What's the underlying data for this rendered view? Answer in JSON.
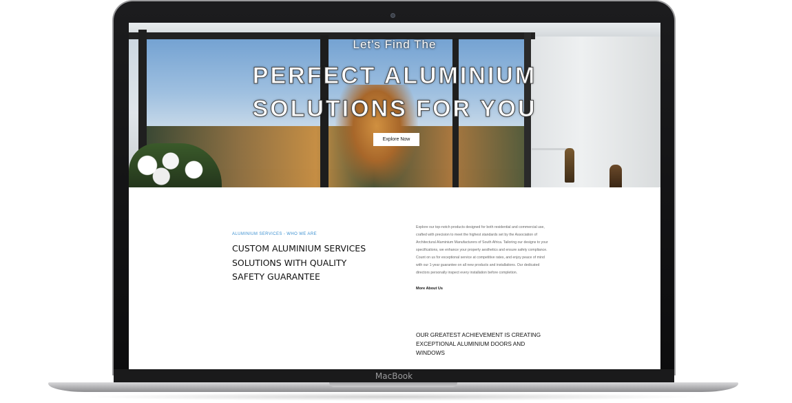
{
  "device": {
    "brand_label": "MacBook"
  },
  "hero": {
    "kicker": "Let's Find The",
    "title_line1": "PERFECT ALUMINIUM",
    "title_line2": "SOLUTIONS FOR YOU",
    "cta_label": "Explore Now"
  },
  "about": {
    "kicker": "ALUMINIUM SERVICES - WHO WE ARE",
    "headline_lines": [
      "CUSTOM ALUMINIUM SERVICES",
      "SOLUTIONS WITH QUALITY",
      "SAFETY GUARANTEE"
    ],
    "body_lines": [
      "Explore our top-notch products designed for both residential and commercial use,",
      "crafted with precision to meet the highest standards set by the Association of",
      "Architectural Aluminium Manufacturers of South Africa. Tailoring our designs to your",
      "specifications, we enhance your property aesthetics and ensure safety compliance.",
      "Count on us for exceptional service at competitive rates, and enjoy peace of mind",
      "with our 1-year guarantee on all new products and installations. Our dedicated",
      "directors personally inspect every installation before completion."
    ],
    "link_label": "More About Us"
  },
  "achievement": {
    "lines": [
      "OUR GREATEST ACHIEVEMENT IS CREATING",
      "EXCEPTIONAL ALUMINIUM DOORS AND",
      "WINDOWS"
    ]
  },
  "colors": {
    "accent_blue": "#3a8fd0",
    "text_dark": "#111111",
    "body_gray": "#666666"
  }
}
